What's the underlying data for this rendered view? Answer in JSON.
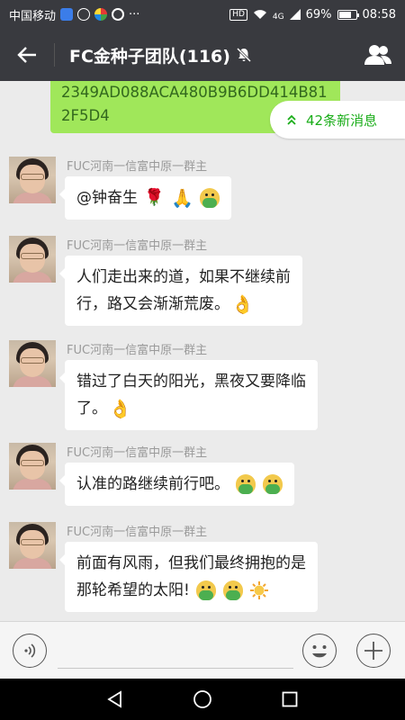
{
  "status_bar": {
    "carrier": "中国移动",
    "dots": "···",
    "hd": "HD",
    "network": "4G",
    "battery": "69%",
    "battery_level": 0.69,
    "time": "08:58"
  },
  "header": {
    "title": "FC金种子团队(116)",
    "back_icon": "arrow-left-icon",
    "mute_icon": "bell-off-icon",
    "members_icon": "group-icon"
  },
  "chat": {
    "own_message_tail": "2349AD088ACA480B9B6DD414B812F5D4",
    "new_messages_label": "42条新消息",
    "new_messages_icon": "double-chevron-up-icon",
    "messages": [
      {
        "sender": "FUC河南一信富中原一群主",
        "text": "@钟奋生"
      },
      {
        "sender": "FUC河南一信富中原一群主",
        "line1": "人们走出来的道，如果不继续前",
        "line2": "行，路又会渐渐荒废。"
      },
      {
        "sender": "FUC河南一信富中原一群主",
        "line1": "错过了白天的阳光，黑夜又要降临",
        "line2": "了。"
      },
      {
        "sender": "FUC河南一信富中原一群主",
        "text": "认准的路继续前行吧。"
      },
      {
        "sender": "FUC河南一信富中原一群主",
        "line1": "前面有风雨，但我们最终拥抱的是",
        "line2": "那轮希望的太阳!"
      }
    ]
  },
  "input_bar": {
    "voice_icon": "voice-icon",
    "emoji_icon": "smiley-icon",
    "plus_icon": "plus-icon"
  },
  "nav_bar": {
    "back_icon": "triangle-back-icon",
    "home_icon": "circle-home-icon",
    "recents_icon": "square-recents-icon"
  },
  "colors": {
    "header_bg": "#393a3f",
    "chat_bg": "#ebebeb",
    "own_bubble": "#a0e75a",
    "accent_green": "#1aad19"
  }
}
